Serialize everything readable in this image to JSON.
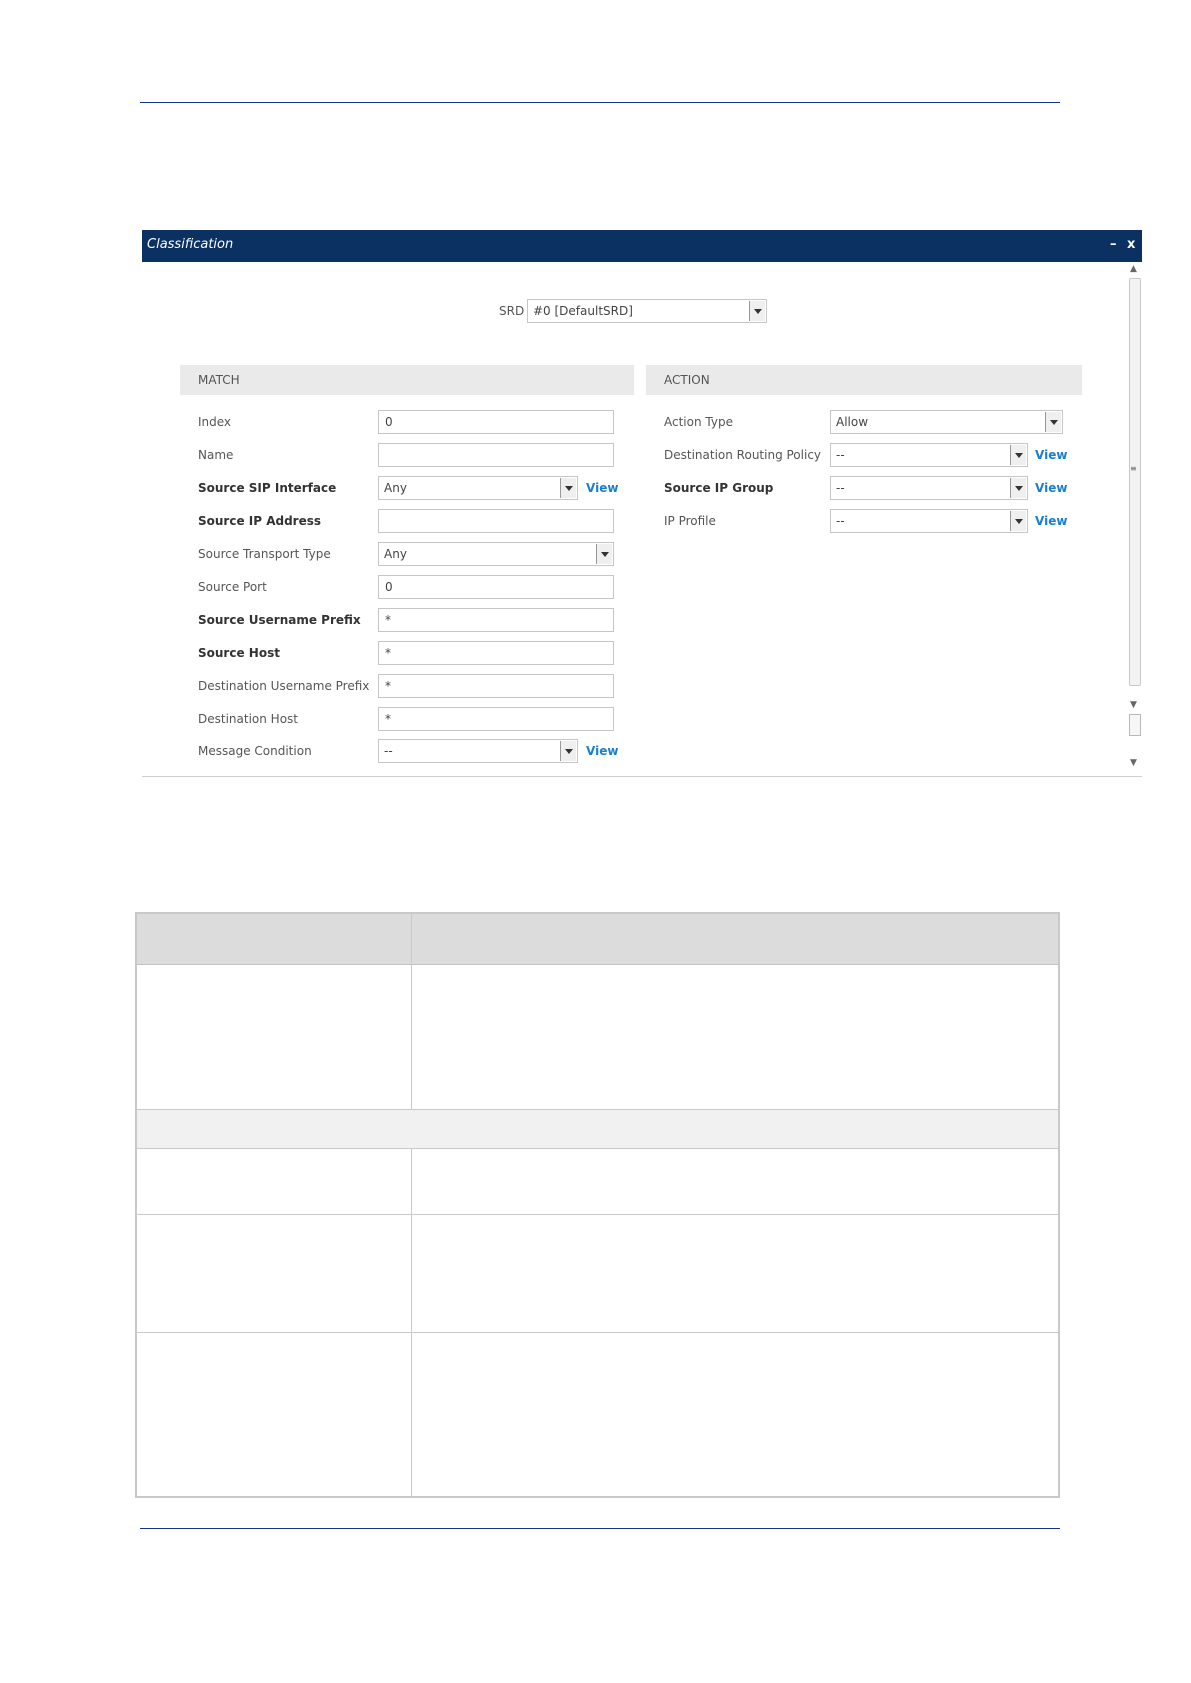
{
  "dialog": {
    "title": "Classification",
    "minimize_label": "–",
    "close_label": "x",
    "srd": {
      "label": "SRD",
      "value": "#0 [DefaultSRD]"
    }
  },
  "match": {
    "header": "MATCH",
    "fields": {
      "index": {
        "label": "Index",
        "value": "0"
      },
      "name": {
        "label": "Name",
        "value": ""
      },
      "source_sip_interface": {
        "label": "Source SIP Interface",
        "value": "Any",
        "view": "View"
      },
      "source_ip_address": {
        "label": "Source IP Address",
        "value": ""
      },
      "source_transport_type": {
        "label": "Source Transport Type",
        "value": "Any"
      },
      "source_port": {
        "label": "Source Port",
        "value": "0"
      },
      "source_username_prefix": {
        "label": "Source Username Prefix",
        "value": "*"
      },
      "source_host": {
        "label": "Source Host",
        "value": "*"
      },
      "destination_username_prefix": {
        "label": "Destination Username Prefix",
        "value": "*"
      },
      "destination_host": {
        "label": "Destination Host",
        "value": "*"
      },
      "message_condition": {
        "label": "Message Condition",
        "value": "--",
        "view": "View"
      }
    }
  },
  "action": {
    "header": "ACTION",
    "fields": {
      "action_type": {
        "label": "Action Type",
        "value": "Allow"
      },
      "destination_routing_policy": {
        "label": "Destination Routing Policy",
        "value": "--",
        "view": "View"
      },
      "source_ip_group": {
        "label": "Source IP Group",
        "value": "--",
        "view": "View"
      },
      "ip_profile": {
        "label": "IP Profile",
        "value": "--",
        "view": "View"
      }
    }
  },
  "colors": {
    "titlebar": "#0b3163",
    "link": "#1a7fcc",
    "rule": "#1a2f8a",
    "section_bg": "#eaeaea"
  }
}
